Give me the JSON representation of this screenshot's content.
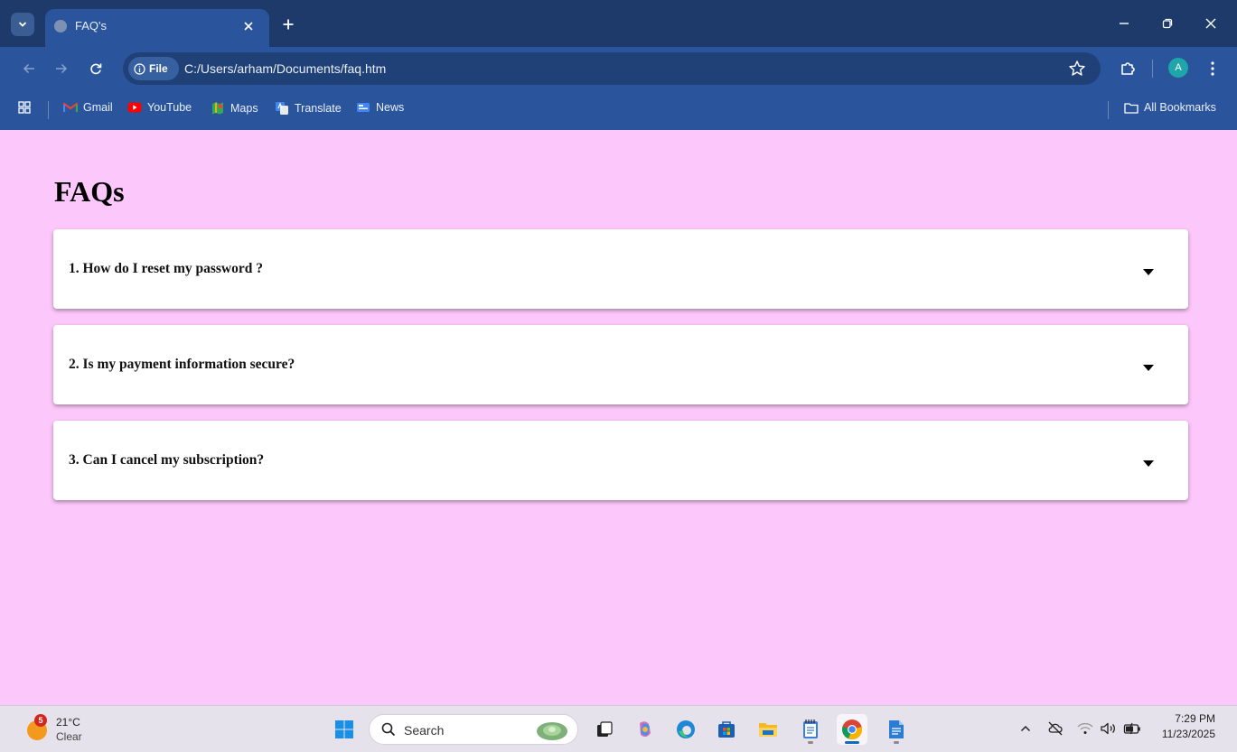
{
  "browser": {
    "tab_title": "FAQ's",
    "site_chip": "File",
    "url": "C:/Users/arham/Documents/faq.htm",
    "profile_initial": "A",
    "bookmarks": [
      "Gmail",
      "YouTube",
      "Maps",
      "Translate",
      "News"
    ],
    "all_bookmarks": "All Bookmarks"
  },
  "page": {
    "title": "FAQs",
    "faqs": [
      {
        "question": "1. How do I reset my password ?"
      },
      {
        "question": "2. Is my payment information secure?"
      },
      {
        "question": "3. Can I cancel my subscription?"
      }
    ]
  },
  "taskbar": {
    "weather_badge": "5",
    "weather_temp": "21°C",
    "weather_condition": "Clear",
    "search_label": "Search",
    "time": "7:29 PM",
    "date": "11/23/2025"
  },
  "colors": {
    "page_background": "#fcc7fa",
    "chrome_dark": "#1e3a6b",
    "chrome_toolbar": "#2a559c"
  }
}
